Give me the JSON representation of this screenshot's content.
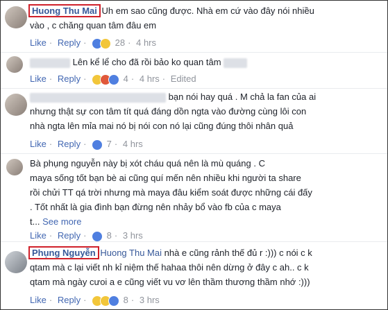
{
  "comments": [
    {
      "name": "Huong Thu Mai",
      "text_line1": "Uh em sao cũng được. Nhà em cứ vào đây nói nhiều",
      "text_line2": "vào , c chăng quan tâm đâu em",
      "like": "Like",
      "reply": "Reply",
      "reaction_count": "28",
      "time": "4 hrs"
    },
    {
      "text": "Lên kể lể cho đã rồi bảo ko quan tâm",
      "like": "Like",
      "reply": "Reply",
      "reaction_count": "4",
      "time": "4 hrs",
      "edited": "Edited"
    },
    {
      "text_line1": "bạn nói hay quá . M chả la fan của ai",
      "text_line2": "nhưng thật sự con tâm tít quá đáng dồn ngta vào đường cùng lôi con",
      "text_line3": "nhà ngta lên mỉa mai nó bị nói con nó lại cũng đúng thôi nhân quả",
      "like": "Like",
      "reply": "Reply",
      "reaction_count": "7",
      "time": "4 hrs"
    },
    {
      "text_line1": "Bà phụng nguyễn này bị xót cháu quá nên là mù quáng . C",
      "text_line2": "maya sống tốt bạn bè ai cũng quí mến nên nhiều khi người ta share",
      "text_line3": "rồi chửi TT qá trời nhưng mà maya đâu kiểm soát được những cái đấy",
      "text_line4": ". Tốt nhất là gia đình bạn đừng nên nhảy bổ vào fb của c maya",
      "text_line5": "t...",
      "see_more": "See more",
      "like": "Like",
      "reply": "Reply",
      "reaction_count": "8",
      "time": "3 hrs"
    },
    {
      "name": "Phụng Nguyễn",
      "mention": "Huong Thu Mai",
      "text_line1": "nhà e cũng rảnh thế đủ r :))) c nói c k",
      "text_line2": "qtam mà c lại viết nh kỉ niệm thế hahaa thôi nên dừng ở đây c ah.. c k",
      "text_line3": "qtam mà ngày cưoi a e cũng viết vu vơ lên thầm thương thầm nhớ :)))",
      "like": "Like",
      "reply": "Reply",
      "reaction_count": "8",
      "time": "3 hrs"
    }
  ],
  "colors": {
    "link": "#4267b2",
    "name": "#365899",
    "highlight_box": "#d0202a"
  },
  "icons": [
    "like-reaction-icon",
    "haha-reaction-icon",
    "angry-reaction-icon",
    "sad-reaction-icon"
  ]
}
